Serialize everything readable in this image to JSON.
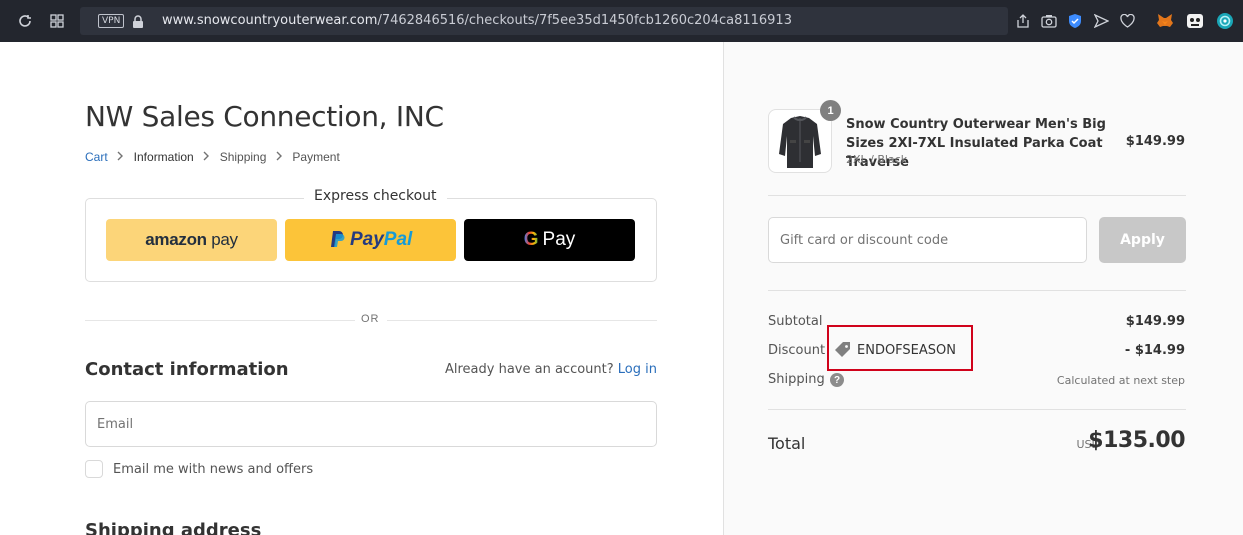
{
  "browser": {
    "vpn_label": "VPN",
    "url_host": "www.snowcountryouterwear.com",
    "url_path": "/7462846516/checkouts/7f5ee35d1450fcb1260c204ca8116913"
  },
  "store": {
    "name": "NW Sales Connection, INC"
  },
  "breadcrumb": {
    "cart": "Cart",
    "information": "Information",
    "shipping": "Shipping",
    "payment": "Payment"
  },
  "express": {
    "title": "Express checkout",
    "amazon_brand": "amazon",
    "amazon_pay": "pay",
    "paypal_1": "Pay",
    "paypal_2": "Pal",
    "gpay_g": "G",
    "gpay_label": "Pay"
  },
  "divider_or": "OR",
  "contact": {
    "title": "Contact information",
    "account_prompt": "Already have an account?",
    "login_label": "Log in",
    "email_placeholder": "Email",
    "newsletter_label": "Email me with news and offers"
  },
  "shipping_title": "Shipping address",
  "order": {
    "product_name": "Snow Country Outerwear Men's Big Sizes 2XI-7XL Insulated Parka Coat Traverse",
    "product_variant": "2XL / Black",
    "product_price": "$149.99",
    "quantity": "1",
    "discount_placeholder": "Gift card or discount code",
    "apply_label": "Apply",
    "subtotal_label": "Subtotal",
    "subtotal_value": "$149.99",
    "discount_label": "Discount",
    "discount_code": "ENDOFSEASON",
    "discount_value": "- $14.99",
    "shipping_label": "Shipping",
    "shipping_value": "Calculated at next step",
    "total_label": "Total",
    "total_currency": "USD",
    "total_value": "$135.00"
  },
  "colors": {
    "link": "#2a6ebb",
    "highlight": "#d0021b",
    "amazon": "#fcd579",
    "paypal": "#fcc439"
  }
}
